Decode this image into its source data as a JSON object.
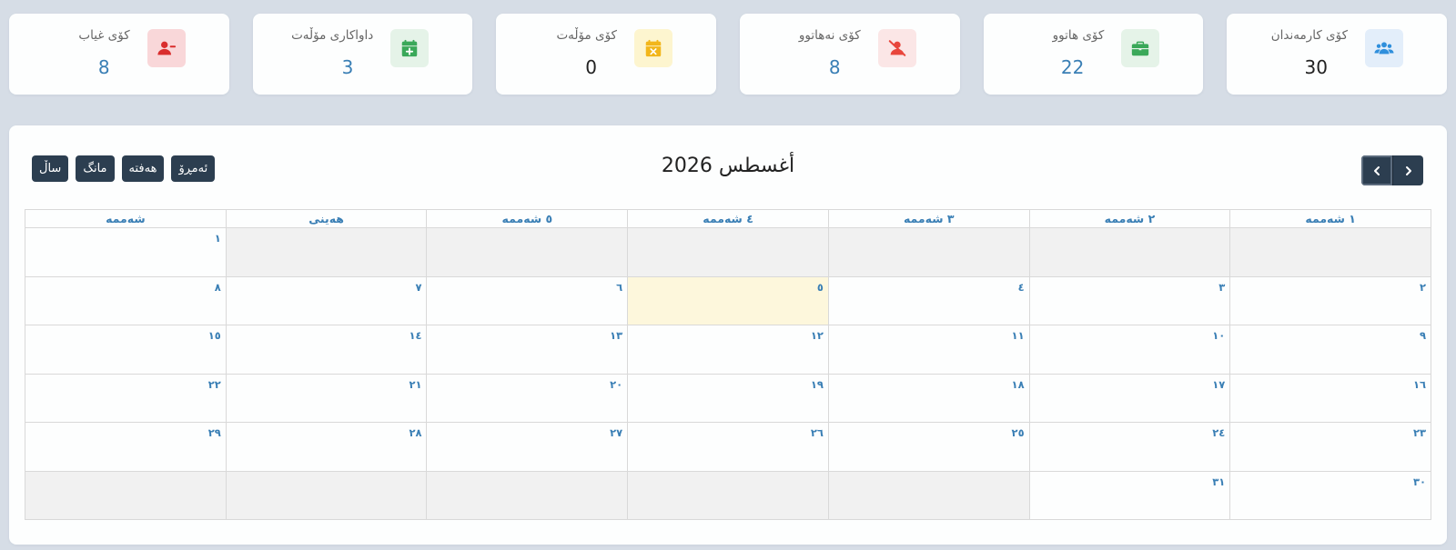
{
  "colors": {
    "page_bg": "#d6dde6",
    "accent_blue": "#3a7fb5",
    "nav_button": "#2c3e50",
    "today_highlight": "#fdf7dc"
  },
  "stats": [
    {
      "label": "کۆی کارمەندان",
      "value": "30",
      "icon": "users-icon",
      "icon_color": "#2f8fdc",
      "icon_bg": "#e3eefa",
      "value_color": "#222222"
    },
    {
      "label": "کۆی هاتوو",
      "value": "22",
      "icon": "briefcase-icon",
      "icon_color": "#3aa859",
      "icon_bg": "#e5f3e8",
      "value_color": "#3a7fb5"
    },
    {
      "label": "کۆی نەهاتوو",
      "value": "8",
      "icon": "user-slash-icon",
      "icon_color": "#e8463c",
      "icon_bg": "#fbe6e6",
      "value_color": "#3a7fb5"
    },
    {
      "label": "کۆی مۆڵەت",
      "value": "0",
      "icon": "calendar-x-icon",
      "icon_color": "#f2b61b",
      "icon_bg": "#fdf5cf",
      "value_color": "#222222"
    },
    {
      "label": "داواکاری مۆڵەت",
      "value": "3",
      "icon": "calendar-plus-icon",
      "icon_color": "#3aa859",
      "icon_bg": "#e5f3e8",
      "value_color": "#3a7fb5"
    },
    {
      "label": "کۆی غیاب",
      "value": "8",
      "icon": "user-minus-icon",
      "icon_color": "#d92d2d",
      "icon_bg": "#f9d7d9",
      "value_color": "#3a7fb5"
    }
  ],
  "calendar": {
    "title": "أغسطس 2026",
    "views": {
      "today": "ئەمڕۆ",
      "week": "هەفتە",
      "month": "مانگ",
      "year": "ساڵ"
    },
    "weekdays": [
      "١ شەممە",
      "٢ شەممە",
      "٣ شەممە",
      "٤ شەممە",
      "٥ شەممە",
      "هەینی",
      "شەممە"
    ],
    "weeks": [
      [
        "",
        "",
        "",
        "",
        "",
        "",
        "١"
      ],
      [
        "٢",
        "٣",
        "٤",
        "٥",
        "٦",
        "٧",
        "٨"
      ],
      [
        "٩",
        "١٠",
        "١١",
        "١٢",
        "١٣",
        "١٤",
        "١٥"
      ],
      [
        "١٦",
        "١٧",
        "١٨",
        "١٩",
        "٢٠",
        "٢١",
        "٢٢"
      ],
      [
        "٢٣",
        "٢٤",
        "٢٥",
        "٢٦",
        "٢٧",
        "٢٨",
        "٢٩"
      ],
      [
        "٣٠",
        "٣١",
        "",
        "",
        "",
        "",
        ""
      ]
    ],
    "today": "٥"
  }
}
